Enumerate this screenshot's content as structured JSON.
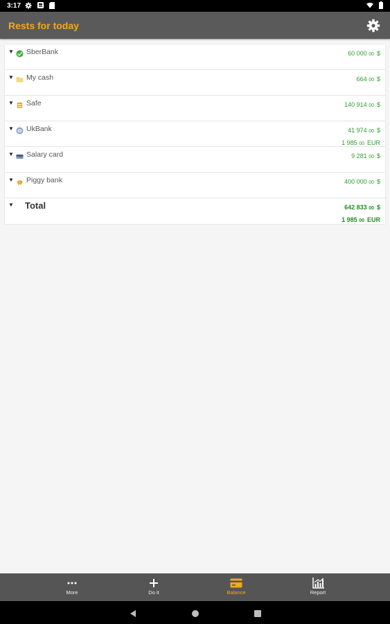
{
  "status_bar": {
    "time": "3:17",
    "left_icons": [
      "gear-icon",
      "notification-icon",
      "sd-card-icon"
    ],
    "right_icons": [
      "wifi-icon",
      "battery-icon"
    ]
  },
  "app_bar": {
    "title": "Rests for today",
    "title_color": "#f4a91a",
    "settings_icon": "gear-icon"
  },
  "accounts": [
    {
      "name": "SberBank",
      "icon": "sberbank-icon",
      "amounts": [
        {
          "main": "60 000",
          "cents": "00",
          "currency": "$"
        }
      ]
    },
    {
      "name": "My cash",
      "icon": "folder-icon",
      "amounts": [
        {
          "main": "664",
          "cents": "00",
          "currency": "$"
        }
      ]
    },
    {
      "name": "Safe",
      "icon": "safe-icon",
      "amounts": [
        {
          "main": "140 914",
          "cents": "00",
          "currency": "$"
        }
      ]
    },
    {
      "name": "UkBank",
      "icon": "bank-icon",
      "amounts": [
        {
          "main": "41 974",
          "cents": "00",
          "currency": "$"
        },
        {
          "main": "1 985",
          "cents": "00",
          "currency": "EUR"
        }
      ]
    },
    {
      "name": "Salary card",
      "icon": "card-icon",
      "amounts": [
        {
          "main": "9 281",
          "cents": "00",
          "currency": "$"
        }
      ]
    },
    {
      "name": "Piggy bank",
      "icon": "piggy-bank-icon",
      "amounts": [
        {
          "main": "400 000",
          "cents": "00",
          "currency": "$"
        }
      ]
    }
  ],
  "total": {
    "label": "Total",
    "amounts": [
      {
        "main": "642 833",
        "cents": "00",
        "currency": "$"
      },
      {
        "main": "1 985",
        "cents": "00",
        "currency": "EUR"
      }
    ]
  },
  "bottom_nav": [
    {
      "label": "More",
      "icon": "more-icon",
      "active": false
    },
    {
      "label": "Do it",
      "icon": "plus-icon",
      "active": false
    },
    {
      "label": "Balance",
      "icon": "wallet-icon",
      "active": true
    },
    {
      "label": "Report",
      "icon": "chart-icon",
      "active": false
    }
  ],
  "colors": {
    "accent": "#f4a91a",
    "amount_green": "#2e9e2e",
    "app_bar": "#5a5a5a",
    "bottom_nav": "#555555"
  }
}
